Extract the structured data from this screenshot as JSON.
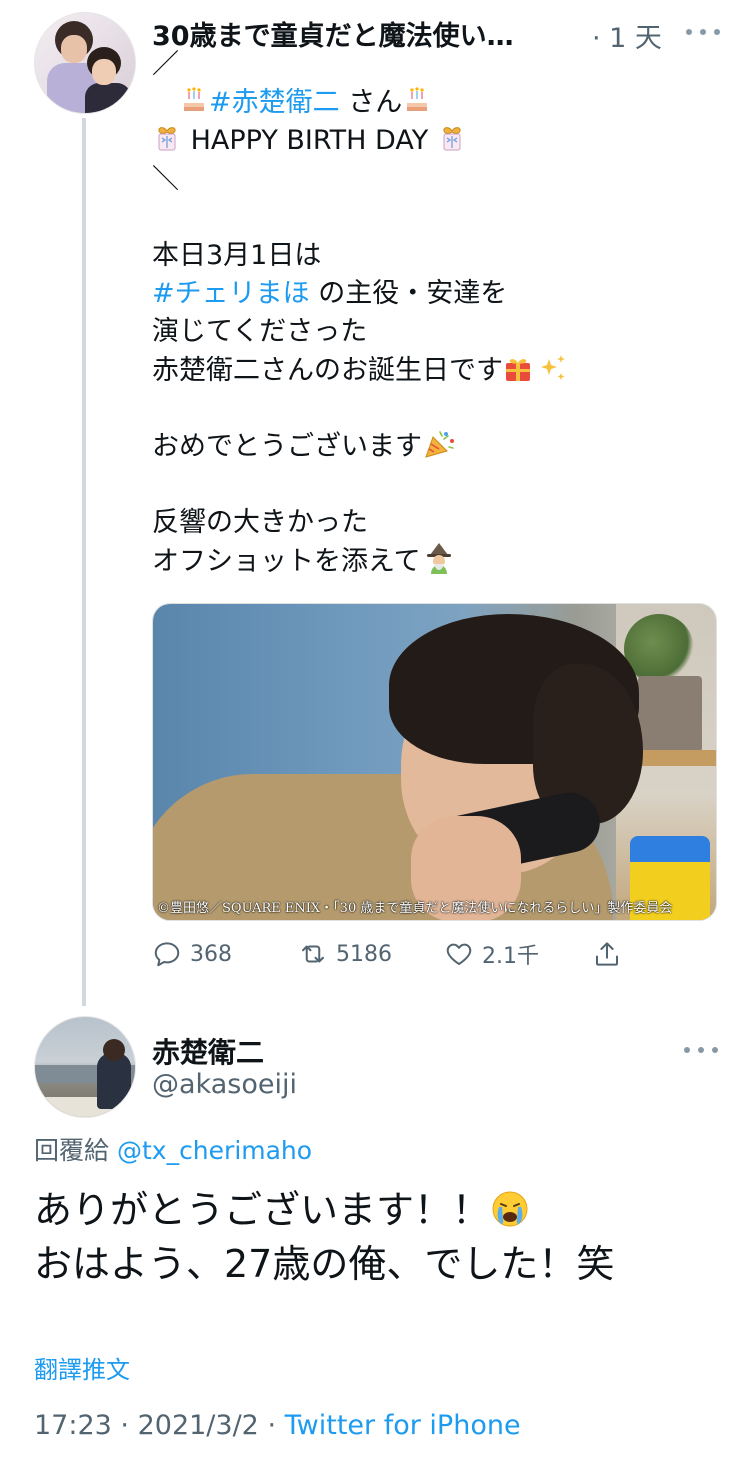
{
  "parent_tweet": {
    "author": "30歳まで童貞だと魔法使い…",
    "time_ago": "· 1 天",
    "text_lines": [
      {
        "plain": "／"
      },
      {
        "prefix": "　",
        "emoji_before": "birthday-cake-emoji",
        "link": "#赤楚衛二",
        "after": " さん",
        "emoji_after": "birthday-cake-emoji"
      },
      {
        "emoji_before": "ribbon-gift-emoji",
        "plain": " HAPPY BIRTH DAY ",
        "emoji_after": "ribbon-gift-emoji"
      },
      {
        "plain": "＼"
      },
      {
        "plain": ""
      },
      {
        "plain": "本日3月1日は"
      },
      {
        "link": "#チェリまほ",
        "after": " の主役・安達を"
      },
      {
        "plain": "演じてくださった"
      },
      {
        "plain": "赤楚衛二さんのお誕生日です",
        "emoji_after": "gift-sparkles-emoji"
      },
      {
        "plain": ""
      },
      {
        "plain": "おめでとうございます",
        "emoji_after": "party-popper-emoji"
      },
      {
        "plain": ""
      },
      {
        "plain": "反響の大きかった"
      },
      {
        "plain": "オフショットを添えて",
        "emoji_after": "mage-emoji"
      }
    ],
    "media_caption": "©豊田悠／SQUARE ENIX・「30 歳まで童貞だと魔法使いになれるらしい」製作委員会",
    "actions": {
      "reply_count": "368",
      "retweet_count": "5186",
      "like_count": "2.1千"
    }
  },
  "reply_tweet": {
    "name": "赤楚衛二",
    "handle": "@akasoeiji",
    "reply_to_label": "回覆給",
    "reply_to_handle": "@tx_cherimaho",
    "body_line1": "ありがとうございます！！",
    "body_line2": "おはよう、27歳の俺、でした！笑",
    "translate_label": "翻譯推文",
    "time": "17:23",
    "date": "2021/3/2",
    "separator": "·",
    "source": "Twitter for iPhone"
  },
  "colors": {
    "link": "#1d9bf0",
    "secondary_text": "#536471",
    "thread_line": "#cfd9de"
  }
}
